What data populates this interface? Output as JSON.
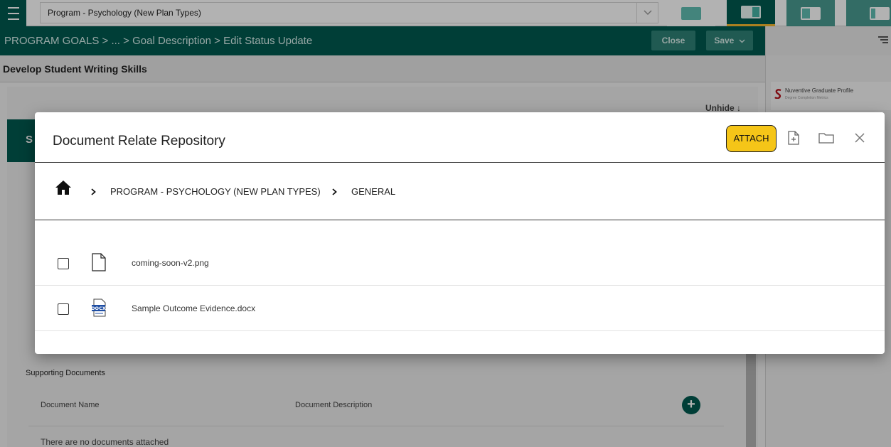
{
  "topbar": {
    "program_select_value": "Program - Psychology (New Plan Types)"
  },
  "nav": {
    "crumbs": [
      "PROGRAM GOALS",
      "...",
      "Goal Description",
      "Edit Status Update"
    ],
    "close_label": "Close",
    "save_label": "Save"
  },
  "page": {
    "title": "Develop Student Writing Skills",
    "unhide_label": "Unhide",
    "tab_letter": "S"
  },
  "side_panel": {
    "card_title": "Nuventive Graduate Profile",
    "card_subtitle": "Degree Completion Metrics"
  },
  "supporting_docs": {
    "title": "Supporting Documents",
    "col_name": "Document Name",
    "col_description": "Document Description",
    "empty_text": "There are no documents attached"
  },
  "modal": {
    "title": "Document Relate Repository",
    "attach_label": "ATTACH",
    "breadcrumb": [
      "PROGRAM - PSYCHOLOGY (NEW PLAN TYPES)",
      "GENERAL"
    ],
    "files": [
      {
        "name": "coming-soon-v2.png",
        "icon": "file-icon"
      },
      {
        "name": "Sample Outcome Evidence.docx",
        "icon": "docx-icon"
      }
    ]
  },
  "colors": {
    "brand_green": "#00594f",
    "accent_yellow": "#f5c518"
  }
}
